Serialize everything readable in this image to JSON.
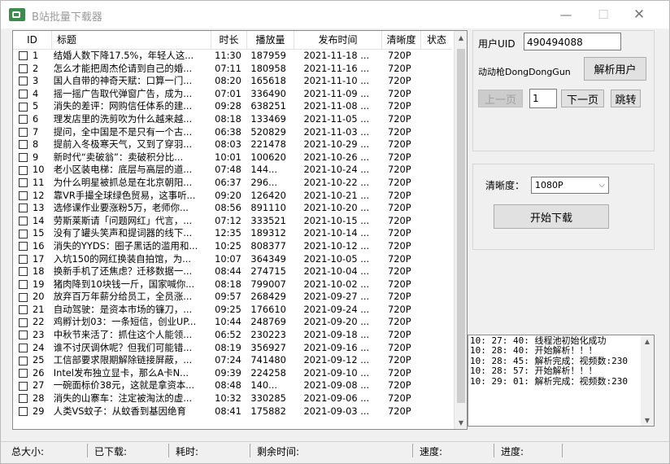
{
  "window": {
    "title": "B站批量下载器",
    "min_glyph": "—",
    "max_glyph": "☐",
    "close_glyph": "✕"
  },
  "table": {
    "headers": {
      "id": "ID",
      "title": "标题",
      "duration": "时长",
      "plays": "播放量",
      "date": "发布时间",
      "resolution": "清晰度",
      "status": "状态"
    },
    "rows": [
      {
        "id": "1",
        "title": "结婚人数下降17.5%，年轻人这...",
        "duration": "11:30",
        "plays": "187959",
        "date": "2021-11-18 ...",
        "resolution": "720P",
        "status": ""
      },
      {
        "id": "2",
        "title": "怎么才能把周杰伦请到自己的婚...",
        "duration": "07:11",
        "plays": "180958",
        "date": "2021-11-16 ...",
        "resolution": "720P",
        "status": ""
      },
      {
        "id": "3",
        "title": "国人自带的神奇天赋：口算一门...",
        "duration": "08:20",
        "plays": "165618",
        "date": "2021-11-10 ...",
        "resolution": "720P",
        "status": ""
      },
      {
        "id": "4",
        "title": "摇一摇广告取代弹窗广告，成为...",
        "duration": "07:01",
        "plays": "336490",
        "date": "2021-11-09 ...",
        "resolution": "720P",
        "status": ""
      },
      {
        "id": "5",
        "title": "消失的差评：网购信任体系的建...",
        "duration": "09:28",
        "plays": "638251",
        "date": "2021-11-08 ...",
        "resolution": "720P",
        "status": ""
      },
      {
        "id": "6",
        "title": "理发店里的洗剪吹为什么越来越...",
        "duration": "08:18",
        "plays": "133469",
        "date": "2021-11-05 ...",
        "resolution": "720P",
        "status": ""
      },
      {
        "id": "7",
        "title": "提问，全中国是不是只有一个古...",
        "duration": "06:38",
        "plays": "520829",
        "date": "2021-11-03 ...",
        "resolution": "720P",
        "status": ""
      },
      {
        "id": "8",
        "title": "提前入冬极寒天气，又到了穿羽...",
        "duration": "08:03",
        "plays": "221478",
        "date": "2021-10-29 ...",
        "resolution": "720P",
        "status": ""
      },
      {
        "id": "9",
        "title": "新时代“卖破翁”：卖破积分比...",
        "duration": "10:01",
        "plays": "100620",
        "date": "2021-10-26 ...",
        "resolution": "720P",
        "status": ""
      },
      {
        "id": "10",
        "title": "老小区装电梯：底层与高层的道...",
        "duration": "07:48",
        "plays": "144...",
        "date": "2021-10-24 ...",
        "resolution": "720P",
        "status": ""
      },
      {
        "id": "11",
        "title": "为什么明星被抓总是在北京朝阳...",
        "duration": "06:37",
        "plays": "296...",
        "date": "2021-10-22 ...",
        "resolution": "720P",
        "status": ""
      },
      {
        "id": "12",
        "title": "靠VR手撮全球绿色贸易，这事听...",
        "duration": "09:20",
        "plays": "126420",
        "date": "2021-10-21 ...",
        "resolution": "720P",
        "status": ""
      },
      {
        "id": "13",
        "title": "选修课作业要涨粉5万，老师你...",
        "duration": "08:56",
        "plays": "891110",
        "date": "2021-10-20 ...",
        "resolution": "720P",
        "status": ""
      },
      {
        "id": "14",
        "title": "劳斯莱斯请「问题网红」代言，...",
        "duration": "07:12",
        "plays": "333521",
        "date": "2021-10-15 ...",
        "resolution": "720P",
        "status": ""
      },
      {
        "id": "15",
        "title": "没有了罐头笑声和提词器的线下...",
        "duration": "12:35",
        "plays": "189312",
        "date": "2021-10-14 ...",
        "resolution": "720P",
        "status": ""
      },
      {
        "id": "16",
        "title": "消失的YYDS：圈子黑话的滥用和...",
        "duration": "10:25",
        "plays": "808377",
        "date": "2021-10-12 ...",
        "resolution": "720P",
        "status": ""
      },
      {
        "id": "17",
        "title": "入坑150的网红换装自拍馆，为...",
        "duration": "10:07",
        "plays": "364349",
        "date": "2021-10-05 ...",
        "resolution": "720P",
        "status": ""
      },
      {
        "id": "18",
        "title": "换新手机了还焦虑？迁移数据一...",
        "duration": "08:44",
        "plays": "274715",
        "date": "2021-10-04 ...",
        "resolution": "720P",
        "status": ""
      },
      {
        "id": "19",
        "title": "猪肉降到10块钱一斤，国家喊你...",
        "duration": "08:18",
        "plays": "799007",
        "date": "2021-10-02 ...",
        "resolution": "720P",
        "status": ""
      },
      {
        "id": "20",
        "title": "放弃百万年薪分给员工，全员涨...",
        "duration": "09:57",
        "plays": "268429",
        "date": "2021-09-27 ...",
        "resolution": "720P",
        "status": ""
      },
      {
        "id": "21",
        "title": "自动驾驶：是资本市场的镰刀，...",
        "duration": "09:25",
        "plays": "176610",
        "date": "2021-09-24 ...",
        "resolution": "720P",
        "status": ""
      },
      {
        "id": "22",
        "title": "鸡孵计划03：一条短信，创业UP...",
        "duration": "10:44",
        "plays": "248769",
        "date": "2021-09-20 ...",
        "resolution": "720P",
        "status": ""
      },
      {
        "id": "23",
        "title": "中秋节来活了：抓住这个人能领...",
        "duration": "06:52",
        "plays": "230223",
        "date": "2021-09-18 ...",
        "resolution": "720P",
        "status": ""
      },
      {
        "id": "24",
        "title": "谁不讨厌调休呢？但我们可能错...",
        "duration": "08:19",
        "plays": "356927",
        "date": "2021-09-16 ...",
        "resolution": "720P",
        "status": ""
      },
      {
        "id": "25",
        "title": "工信部要求限期解除链接屏蔽，...",
        "duration": "07:24",
        "plays": "741480",
        "date": "2021-09-12 ...",
        "resolution": "720P",
        "status": ""
      },
      {
        "id": "26",
        "title": "Intel发布独立显卡，那么A卡N...",
        "duration": "09:39",
        "plays": "224258",
        "date": "2021-09-10 ...",
        "resolution": "720P",
        "status": ""
      },
      {
        "id": "27",
        "title": "一碗面标价38元，这就是拿资本...",
        "duration": "08:48",
        "plays": "140...",
        "date": "2021-09-08 ...",
        "resolution": "720P",
        "status": ""
      },
      {
        "id": "28",
        "title": "消失的山寨车：注定被淘汰的虚...",
        "duration": "10:32",
        "plays": "330285",
        "date": "2021-09-06 ...",
        "resolution": "720P",
        "status": ""
      },
      {
        "id": "29",
        "title": "人类VS蚊子：从蚊香到基因绝育",
        "duration": "08:41",
        "plays": "175882",
        "date": "2021-09-03 ...",
        "resolution": "720P",
        "status": ""
      }
    ]
  },
  "user": {
    "uid_label": "用户UID",
    "uid_value": "490494088",
    "username": "动动枪DongDongGun",
    "parse_button": "解析用户",
    "prev_button": "上一页",
    "page_value": "1",
    "next_button": "下一页",
    "jump_button": "跳转"
  },
  "download": {
    "resolution_label": "清晰度：",
    "resolution_value": "1080P",
    "start_button": "开始下载"
  },
  "log": [
    "10: 27: 40: 线程池初始化成功",
    "10: 28: 40: 开始解析！！！",
    "10: 28: 45: 解析完成：视频数:230",
    "10: 28: 57: 开始解析！！！",
    "10: 29: 01: 解析完成：视频数:230"
  ],
  "status": {
    "total_size": "总大小:",
    "downloaded": "已下载:",
    "elapsed": "耗时:",
    "remaining": "剩余时间:",
    "speed": "速度:",
    "progress": "进度:"
  }
}
